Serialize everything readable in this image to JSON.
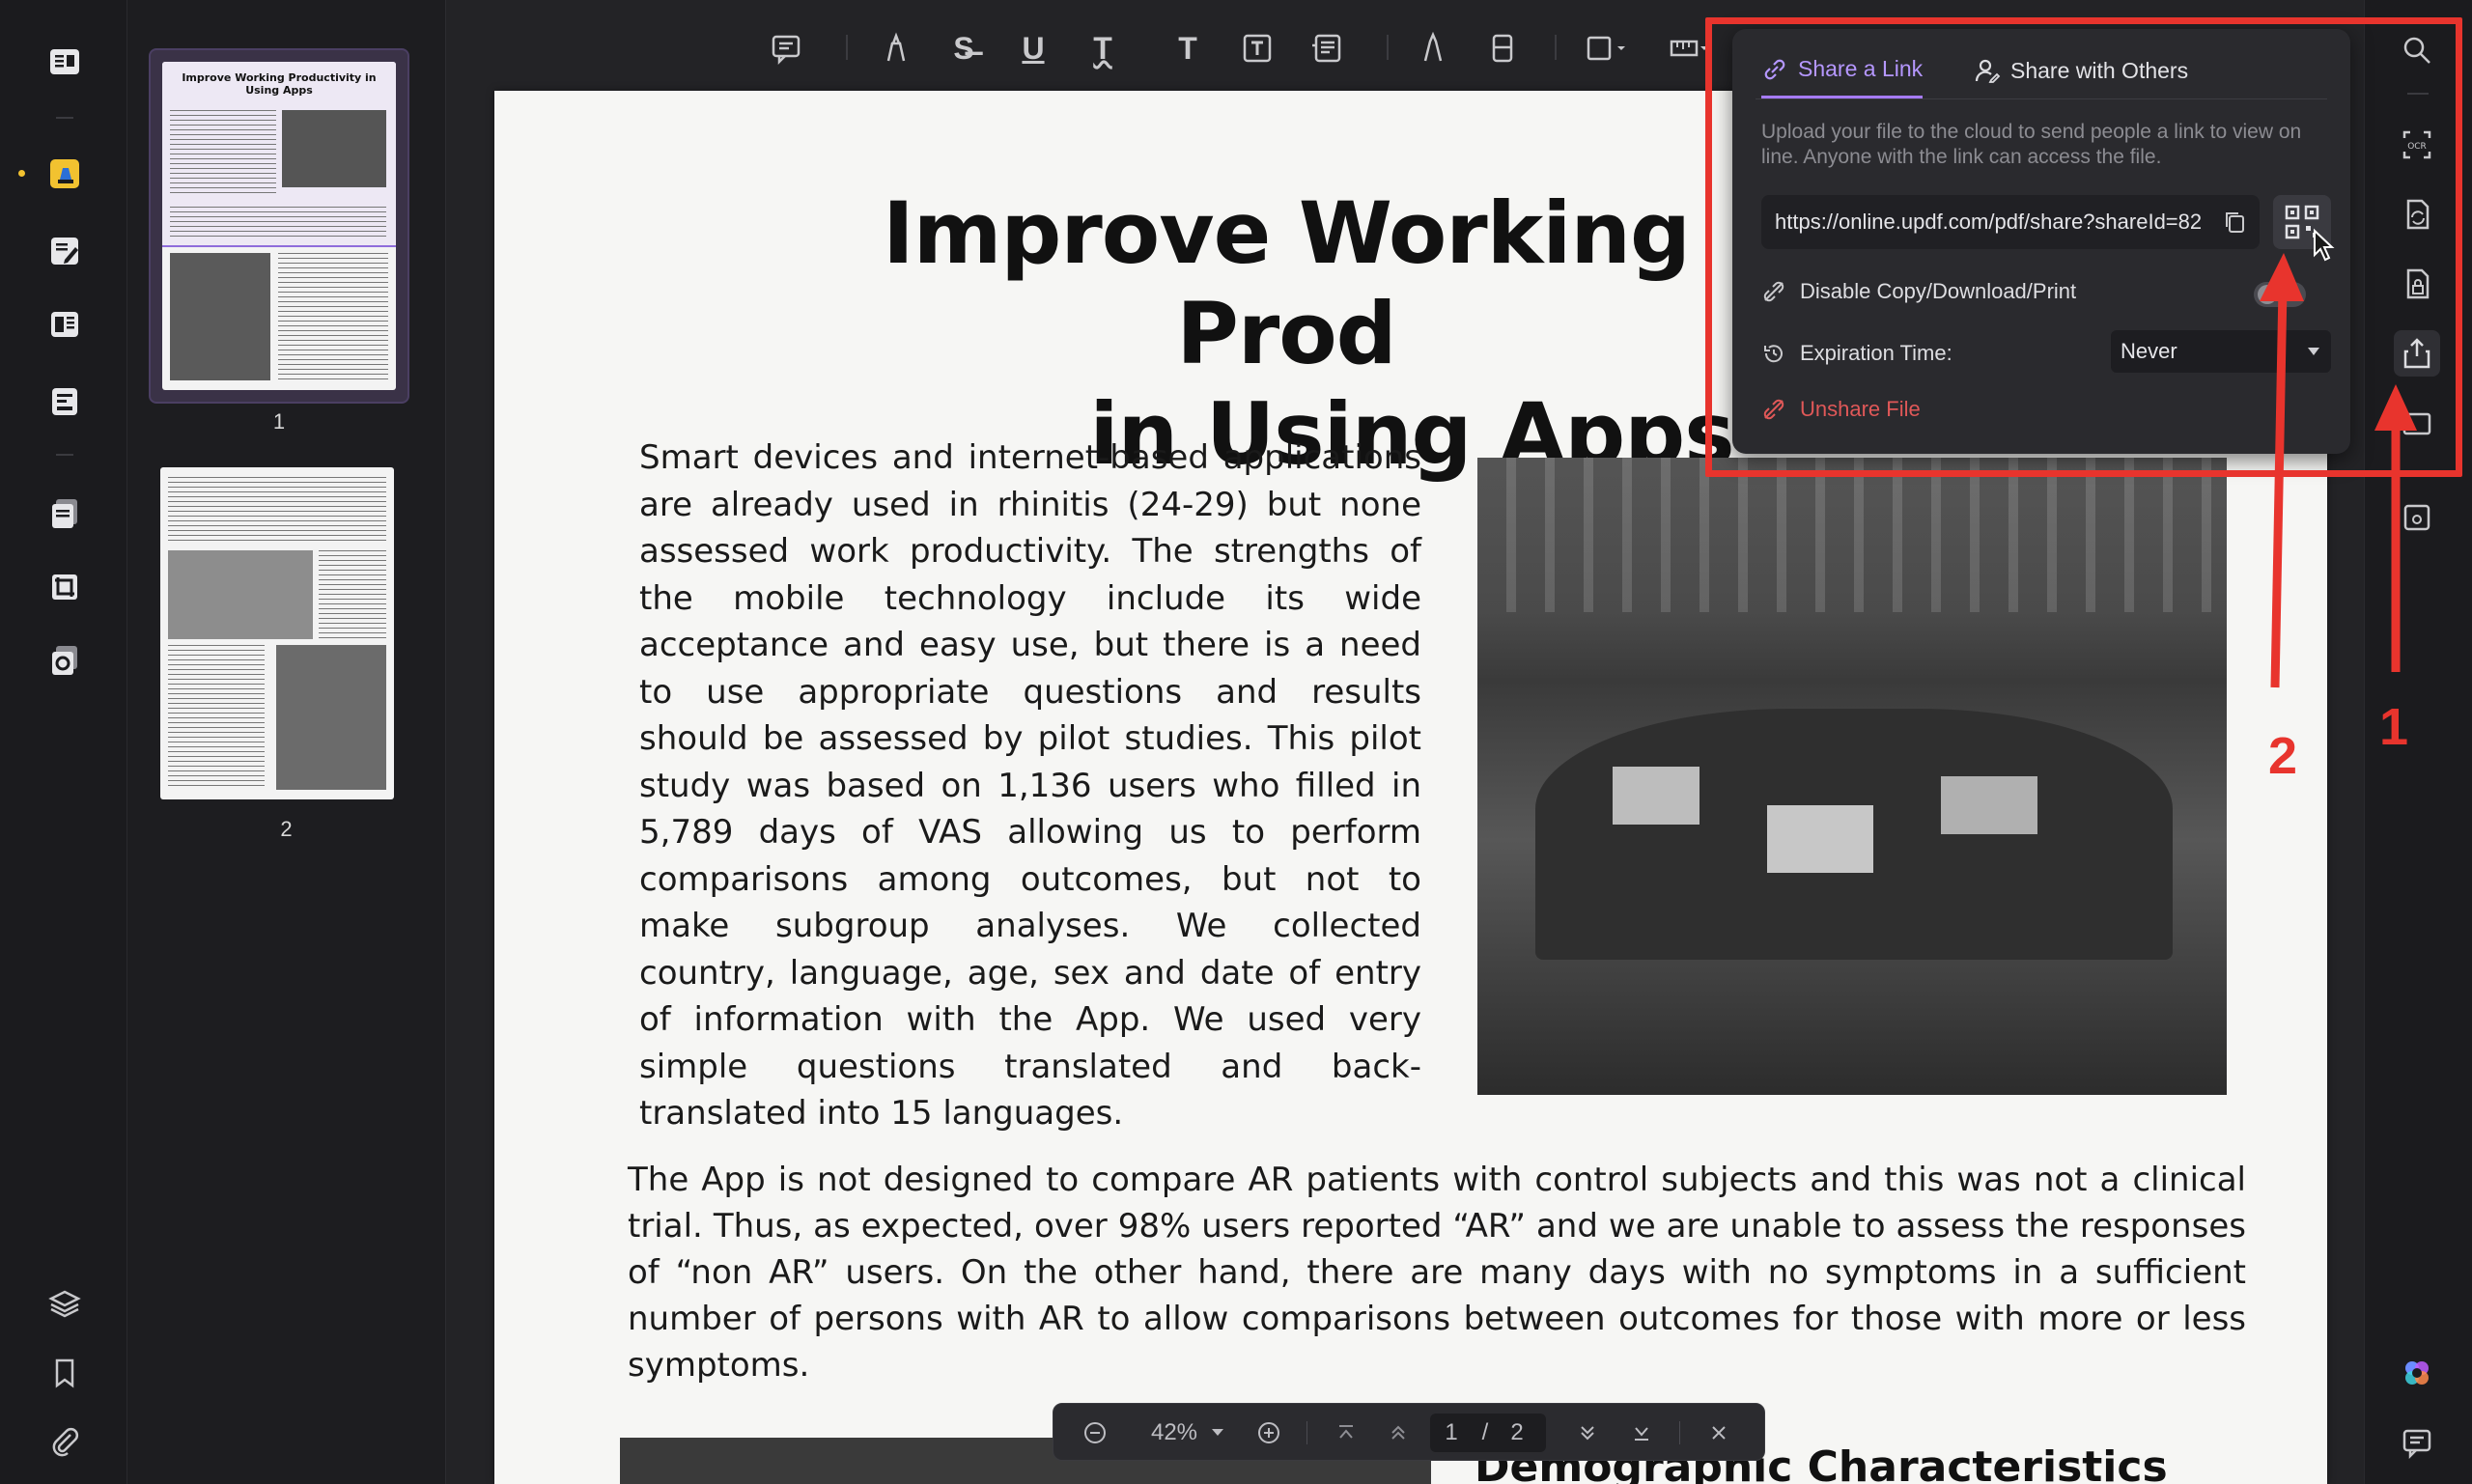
{
  "toolbar": {
    "tools": [
      "comment",
      "highlight",
      "strikethrough",
      "underline",
      "squiggly",
      "text",
      "textbox",
      "text-callout",
      "pencil",
      "eraser",
      "shape",
      "measure"
    ]
  },
  "thumbnails": [
    {
      "label": "1",
      "title": "Improve Working Productivity in Using Apps"
    },
    {
      "label": "2"
    }
  ],
  "document": {
    "title_line1": "Improve Working Prod",
    "title_line2": "in Using Apps",
    "paragraph1": "Smart devices and internet-based applications are already used in rhinitis (24-29) but none assessed work productivity. The strengths of the mobile technology include its wide acceptance and easy use, but there is a need to use appropriate questions and results should be assessed by pilot studies. This pilot study was based on 1,136 users who filled in 5,789 days of VAS allowing us to perform comparisons among outcomes, but not to make subgroup analyses. We collected country, language, age, sex and date of entry of information with the App. We used very simple questions translated and back-translated into 15 languages.",
    "paragraph2": "The App is not designed to compare AR patients with control subjects and this was not a clinical trial. Thus, as expected, over 98% users reported “AR” and we are unable to assess the responses of “non AR” users. On the other hand, there are many days with no symptoms in a sufficient number of persons with AR to allow comparisons between outcomes for those with more or less symptoms.",
    "subheading": "Demographic Characteristics"
  },
  "zoom_bar": {
    "zoom": "42%",
    "current_page": "1",
    "separator": "/",
    "total_pages": "2"
  },
  "share_popover": {
    "tab_link": "Share a Link",
    "tab_others": "Share with Others",
    "description": "Upload your file to the cloud to send people a link to view on line. Anyone with the link can access the file.",
    "link_url": "https://online.updf.com/pdf/share?shareId=82",
    "disable_label": "Disable Copy/Download/Print",
    "disable_enabled": false,
    "expiration_label": "Expiration Time:",
    "expiration_value": "Never",
    "unshare_label": "Unshare File"
  },
  "annotations": {
    "step1": "1",
    "step2": "2",
    "color": "#e8342d"
  }
}
